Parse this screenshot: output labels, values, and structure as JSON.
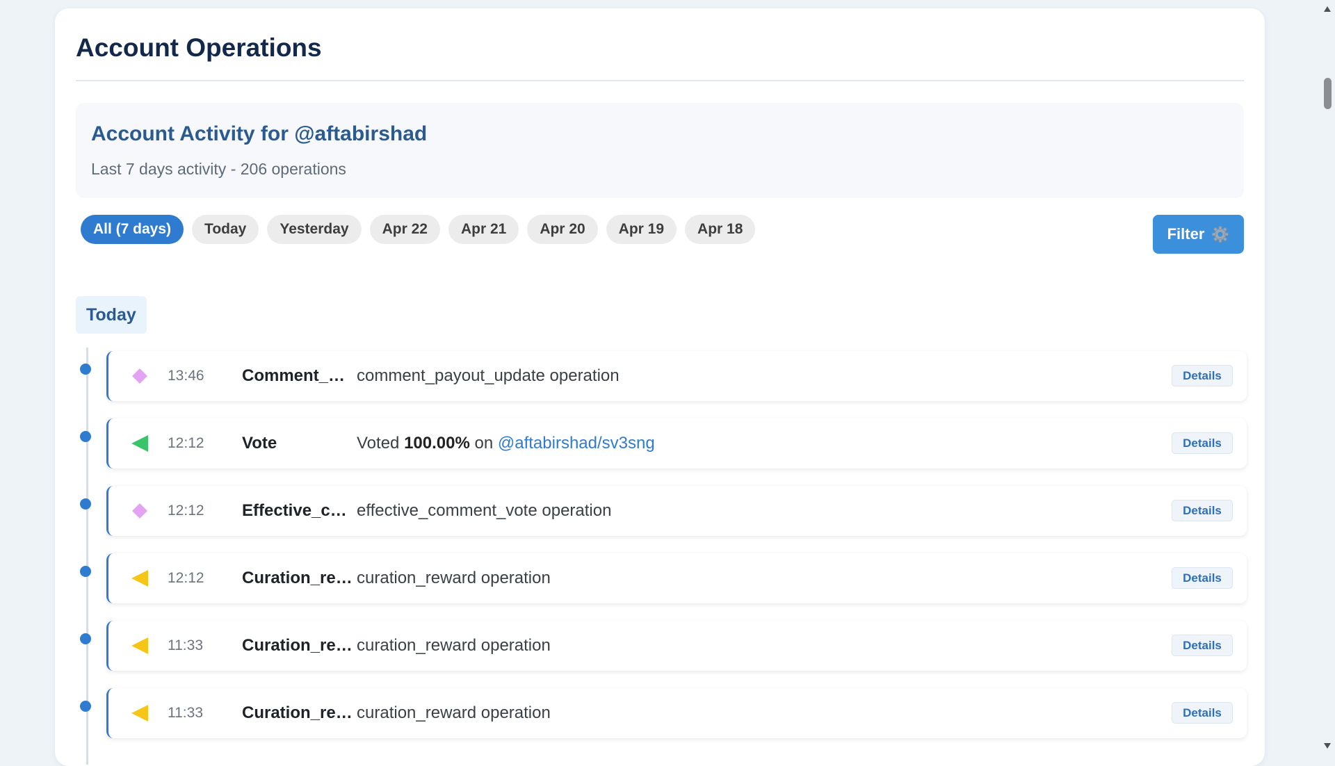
{
  "page": {
    "title": "Account Operations"
  },
  "activity": {
    "heading": "Account Activity for @aftabirshad",
    "subtitle": "Last 7 days activity - 206 operations"
  },
  "filters": {
    "chips": [
      "All (7 days)",
      "Today",
      "Yesterday",
      "Apr 22",
      "Apr 21",
      "Apr 20",
      "Apr 19",
      "Apr 18"
    ],
    "active_chip": "All (7 days)",
    "filter_label": "Filter",
    "filter_icon": "gear-icon"
  },
  "day_group": {
    "label": "Today"
  },
  "operations": [
    {
      "time": "13:46",
      "type": "Comment_payout_update",
      "description": "comment_payout_update operation",
      "icon": "diamond-icon",
      "icon_color": "#e3a3f2",
      "details_label": "Details"
    },
    {
      "time": "12:12",
      "type": "Vote",
      "description_prefix": "Voted",
      "vote_weight": "100.00%",
      "description_mid": "on",
      "link": "@aftabirshad/sv3sng",
      "icon": "arrow-left-icon",
      "icon_color": "#3cc46b",
      "details_label": "Details"
    },
    {
      "time": "12:12",
      "type": "Effective_comment_vote",
      "description": "effective_comment_vote operation",
      "icon": "diamond-icon",
      "icon_color": "#e3a3f2",
      "details_label": "Details"
    },
    {
      "time": "12:12",
      "type": "Curation_reward",
      "description": "curation_reward operation",
      "icon": "arrow-left-icon",
      "icon_color": "#f5c518",
      "details_label": "Details"
    },
    {
      "time": "11:33",
      "type": "Curation_reward",
      "description": "curation_reward operation",
      "icon": "arrow-left-icon",
      "icon_color": "#f5c518",
      "details_label": "Details"
    },
    {
      "time": "11:33",
      "type": "Curation_reward",
      "description": "curation_reward operation",
      "icon": "arrow-left-icon",
      "icon_color": "#f5c518",
      "details_label": "Details"
    }
  ],
  "colors": {
    "accent": "#2f7bd0",
    "filter_button": "#3c8fdb",
    "background": "#eef3f8"
  }
}
